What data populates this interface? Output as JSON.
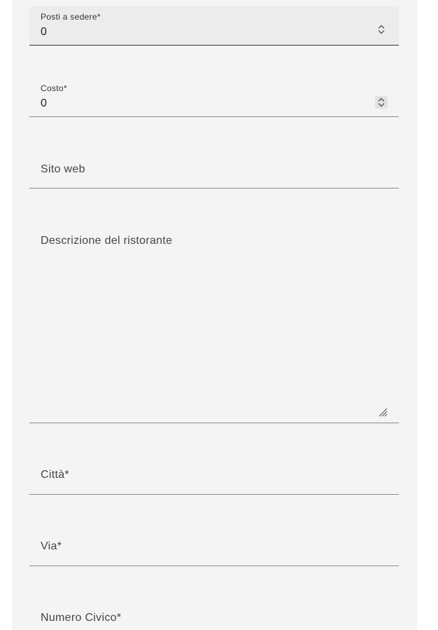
{
  "form": {
    "seats": {
      "label": "Posti a sedere*",
      "value": "0",
      "icon": "spinner-icon"
    },
    "cost": {
      "label": "Costo*",
      "value": "0",
      "icon": "spinner-icon"
    },
    "website": {
      "placeholder": "Sito web"
    },
    "description": {
      "placeholder": "Descrizione del ristorante",
      "icon": "resize-handle-icon"
    },
    "city": {
      "placeholder": "Città*"
    },
    "street": {
      "placeholder": "Via*"
    },
    "street_number": {
      "placeholder": "Numero Civico*"
    }
  },
  "colors": {
    "panel_background": "#f4f4f5",
    "focused_field_background": "#ececec",
    "field_underline": "#8a8a8a",
    "focused_underline": "#2f2f2f",
    "text": "#1f1f1f",
    "placeholder_text": "#444444"
  }
}
